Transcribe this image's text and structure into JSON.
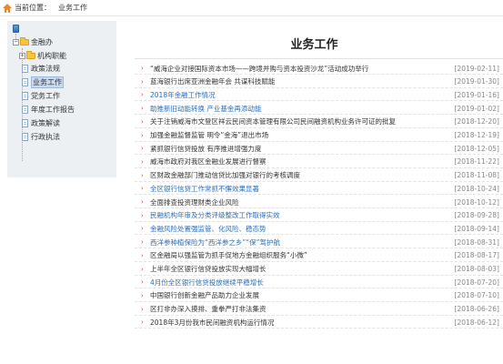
{
  "breadcrumb": {
    "label": "当前位置：",
    "current": "业务工作"
  },
  "sidebar": {
    "root": "金融办",
    "children": [
      {
        "label": "机构职能",
        "expandable": true
      },
      {
        "label": "政策法规"
      },
      {
        "label": "业务工作",
        "selected": true
      },
      {
        "label": "党务工作"
      },
      {
        "label": "年度工作报告"
      },
      {
        "label": "政策解读"
      },
      {
        "label": "行政执法"
      }
    ]
  },
  "main": {
    "title": "业务工作",
    "news": [
      {
        "title": "“威海企业对接国际资本市场——跨境并购与资本投资沙龙”活动成功举行",
        "date": "[2019-02-11]",
        "highlight": false
      },
      {
        "title": "蓝海银行出席亚洲金融年会 共谋科技赋能",
        "date": "[2019-01-30]",
        "highlight": false
      },
      {
        "title": "2018年金融工作情况",
        "date": "[2019-01-16]",
        "highlight": true
      },
      {
        "title": "助推新旧动能转换 产业基金再添动能",
        "date": "[2019-01-02]",
        "highlight": true
      },
      {
        "title": "关于注销威海市文登区祥云民间资本管理有限公司民间融资机构业务许可证的批复",
        "date": "[2018-12-20]",
        "highlight": false
      },
      {
        "title": "加强金融监督监管 明令“金海”退出市场",
        "date": "[2018-12-19]",
        "highlight": false
      },
      {
        "title": "紧抓银行信贷投放 有序推进增强力度",
        "date": "[2018-12-05]",
        "highlight": false
      },
      {
        "title": "威海市政府对我区金融业发展进行督察",
        "date": "[2018-11-22]",
        "highlight": false
      },
      {
        "title": "区财政金融部门推动信贷比加强对银行的考核调度",
        "date": "[2018-11-08]",
        "highlight": false
      },
      {
        "title": "全区银行信贷工作常抓不懈效果显著",
        "date": "[2018-10-24]",
        "highlight": true
      },
      {
        "title": "全面排查投资理财类企业风险",
        "date": "[2018-10-12]",
        "highlight": false
      },
      {
        "title": "民融机构年审及分类评级整改工作取得实效",
        "date": "[2018-09-28]",
        "highlight": true
      },
      {
        "title": "金融风险处置强监管、化风险、稳态势",
        "date": "[2018-09-14]",
        "highlight": true
      },
      {
        "title": "西洋参种植保险为“西洋参之乡”“保”驾护航",
        "date": "[2018-08-31]",
        "highlight": true
      },
      {
        "title": "区金融局以强监管为抓手促地方金融组织服务“小微”",
        "date": "[2018-08-17]",
        "highlight": false
      },
      {
        "title": "上半年全区银行信贷投放实现大幅增长",
        "date": "[2018-08-03]",
        "highlight": false
      },
      {
        "title": "4月份全区银行信贷投放继续平稳增长",
        "date": "[2018-07-20]",
        "highlight": true
      },
      {
        "title": "中国银行创新金融产品助力企业发展",
        "date": "[2018-07-10]",
        "highlight": false
      },
      {
        "title": "区打非办深入摸排、重拳严打非法集资",
        "date": "[2018-06-26]",
        "highlight": false
      },
      {
        "title": "2018年3月份我市民间融资机构运行情况",
        "date": "[2018-06-12]",
        "highlight": false
      }
    ]
  },
  "colors": {
    "link_blue": "#2a6ebb",
    "bullet_red": "#c0392b",
    "sidebar_bg": "#ecf0f3"
  }
}
